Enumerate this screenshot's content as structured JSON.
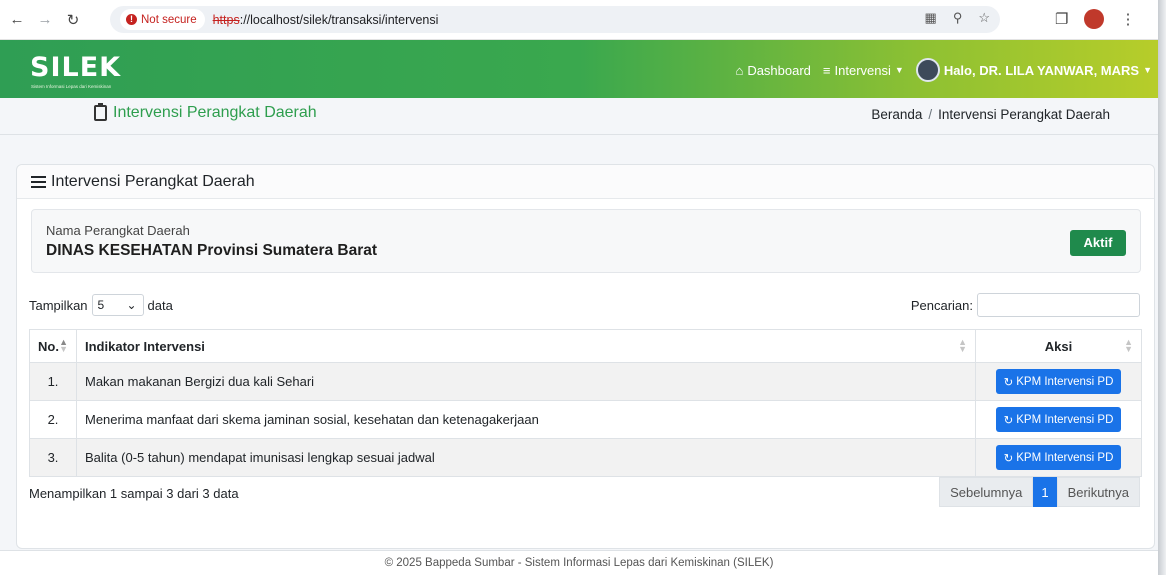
{
  "browser": {
    "not_secure_label": "Not secure",
    "url_scheme": "https",
    "url_rest": "://localhost/silek/transaksi/intervensi"
  },
  "header": {
    "logo": "SILEK",
    "logo_subtitle": "Sistem Informasi Lepas dari Kemiskinan",
    "nav_dashboard": "Dashboard",
    "nav_intervensi": "Intervensi",
    "user_greeting": "Halo, DR. LILA YANWAR, MARS"
  },
  "page": {
    "title": "Intervensi Perangkat Daerah",
    "breadcrumb_home": "Beranda",
    "breadcrumb_sep": "/",
    "breadcrumb_current": "Intervensi Perangkat Daerah"
  },
  "card": {
    "title": "Intervensi Perangkat Daerah",
    "info_label": "Nama Perangkat Daerah",
    "info_value": "DINAS KESEHATAN Provinsi Sumatera Barat",
    "status_badge": "Aktif",
    "length_prefix": "Tampilkan",
    "length_value": "5",
    "length_suffix": "data",
    "search_label": "Pencarian:",
    "search_value": ""
  },
  "table": {
    "headers": {
      "no": "No.",
      "indikator": "Indikator Intervensi",
      "aksi": "Aksi"
    },
    "rows": [
      {
        "no": "1.",
        "indikator": "Makan makanan Bergizi dua kali Sehari",
        "action": "KPM Intervensi PD"
      },
      {
        "no": "2.",
        "indikator": "Menerima manfaat dari skema jaminan sosial, kesehatan dan ketenagakerjaan",
        "action": "KPM Intervensi PD"
      },
      {
        "no": "3.",
        "indikator": "Balita (0-5 tahun) mendapat imunisasi lengkap sesuai jadwal",
        "action": "KPM Intervensi PD"
      }
    ]
  },
  "pagination": {
    "info": "Menampilkan 1 sampai 3 dari 3 data",
    "prev": "Sebelumnya",
    "current": "1",
    "next": "Berikutnya"
  },
  "footer": {
    "text": "© 2025 Bappeda Sumbar - Sistem Informasi Lepas dari Kemiskinan (SILEK)"
  },
  "colors": {
    "brand_green": "#2f9e54",
    "accent_lime": "#b7cd2a",
    "primary_blue": "#1a73e8",
    "badge_green": "#1f8a4c"
  }
}
